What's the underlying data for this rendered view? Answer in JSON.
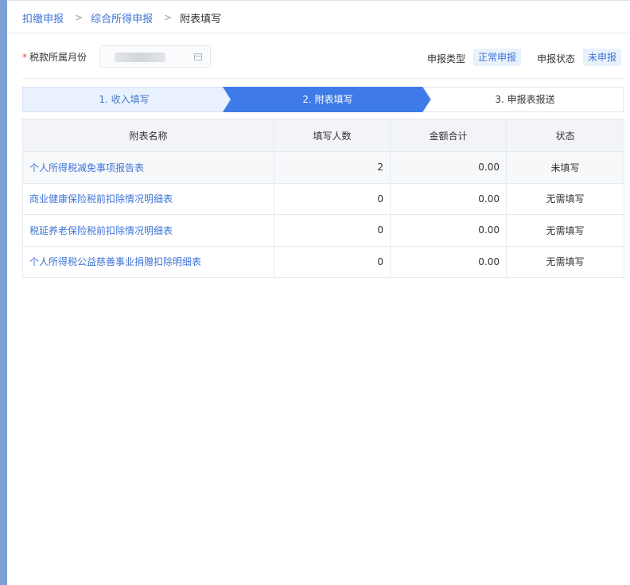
{
  "breadcrumb": {
    "items": [
      "扣缴申报",
      "综合所得申报"
    ],
    "current": "附表填写",
    "separator": ">"
  },
  "filters": {
    "month_label": "税款所属月份",
    "required_mark": "*",
    "month_value": "",
    "declaration_type_label": "申报类型",
    "declaration_type_value": "正常申报",
    "declaration_status_label": "申报状态",
    "declaration_status_value": "未申报"
  },
  "steps": [
    {
      "label": "1. 收入填写",
      "state": "done"
    },
    {
      "label": "2. 附表填写",
      "state": "active"
    },
    {
      "label": "3. 申报表报送",
      "state": "todo"
    }
  ],
  "table": {
    "headers": [
      "附表名称",
      "填写人数",
      "金额合计",
      "状态"
    ],
    "rows": [
      {
        "name": "个人所得税减免事项报告表",
        "count": "2",
        "amount": "0.00",
        "status": "未填写"
      },
      {
        "name": "商业健康保险税前扣除情况明细表",
        "count": "0",
        "amount": "0.00",
        "status": "无需填写"
      },
      {
        "name": "税延养老保险税前扣除情况明细表",
        "count": "0",
        "amount": "0.00",
        "status": "无需填写"
      },
      {
        "name": "个人所得税公益慈善事业捐赠扣除明细表",
        "count": "0",
        "amount": "0.00",
        "status": "无需填写"
      }
    ]
  },
  "colors": {
    "accent": "#3f74d8",
    "step_active": "#3e7be8",
    "step_done": "#e8f1fd",
    "left_strip": "#7f9fd6"
  }
}
